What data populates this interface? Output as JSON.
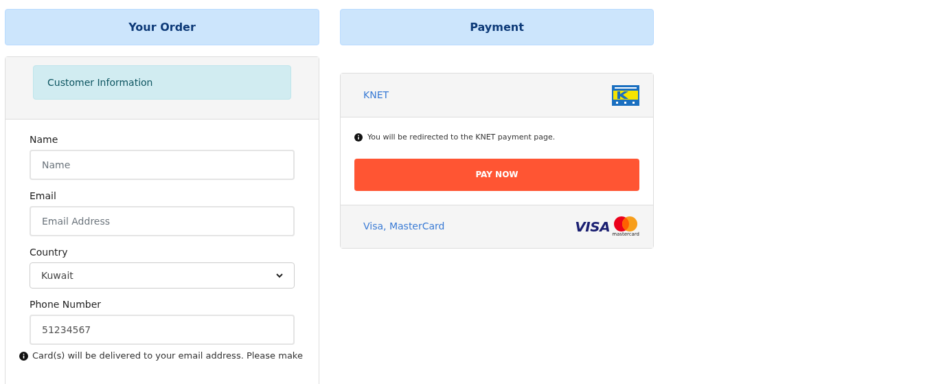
{
  "order": {
    "title": "Your Order",
    "section": "Customer Information",
    "fields": [
      {
        "kind": "input",
        "label": "Name",
        "placeholder": "Name"
      },
      {
        "kind": "input",
        "label": "Email",
        "placeholder": "Email Address"
      },
      {
        "kind": "select",
        "label": "Country",
        "value": "Kuwait"
      },
      {
        "kind": "input",
        "label": "Phone Number",
        "value": "51234567"
      }
    ],
    "note": "Card(s) will be delivered to your email address. Please make"
  },
  "payment": {
    "title": "Payment",
    "methods": [
      {
        "kind": "knet",
        "name": "KNET",
        "expanded": true,
        "info": "You will be redirected to the KNET payment page.",
        "button": "PAY NOW"
      },
      {
        "kind": "cards",
        "name": "Visa, MasterCard",
        "expanded": false,
        "visa": "VISA",
        "mastercard": "mastercard"
      }
    ]
  }
}
